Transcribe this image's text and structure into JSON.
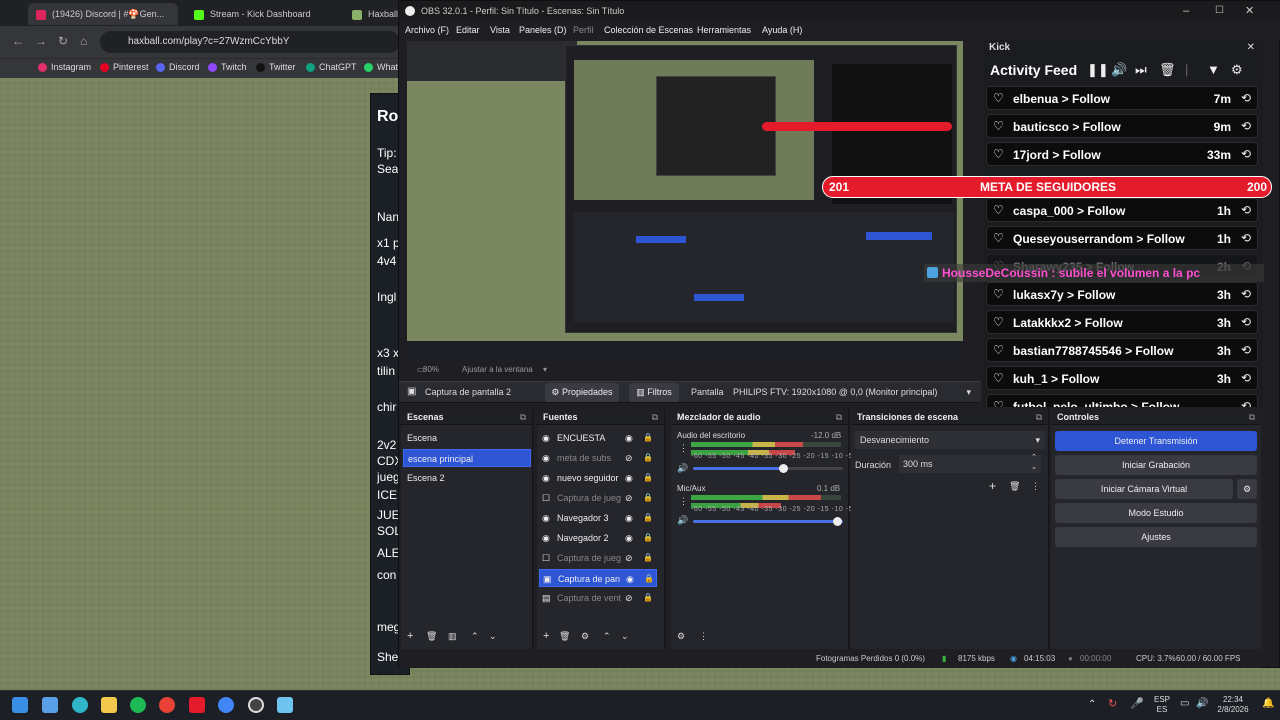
{
  "browser": {
    "tabs": [
      {
        "label": "(19426) Discord | #🍄Gen...",
        "color": "#e0245e"
      },
      {
        "label": "Stream - Kick Dashboard",
        "color": "#53fc18"
      },
      {
        "label": "Haxball Pl",
        "color": "#8ab06a"
      }
    ],
    "url": "haxball.com/play?c=27WzmCcYbbY",
    "bookmarks": [
      {
        "label": "Instagram",
        "color": "#e1306c"
      },
      {
        "label": "Pinterest",
        "color": "#e60023"
      },
      {
        "label": "Discord",
        "color": "#5865f2"
      },
      {
        "label": "Twitch",
        "color": "#9146ff"
      },
      {
        "label": "Twitter",
        "color": "#111111"
      },
      {
        "label": "ChatGPT",
        "color": "#10a37f"
      },
      {
        "label": "Whats",
        "color": "#25d366"
      }
    ]
  },
  "room": {
    "lines": [
      "Ro",
      "Tip:",
      "Sea",
      "Nan",
      "x1 p",
      "4v4",
      "Ingl",
      "x3 x",
      "tilin",
      "chir",
      "2v2",
      "CDX",
      "jueg",
      "ICEE",
      "JUEC",
      "SOL",
      "ALE",
      "con",
      "meg",
      "She"
    ]
  },
  "obs": {
    "title": "OBS 32.0.1 - Perfil: Sin Título - Escenas: Sin Título",
    "menu": [
      "Archivo (F)",
      "Editar",
      "Vista",
      "Paneles (D)",
      "Perfil",
      "Colección de Escenas",
      "Herramientas",
      "Ayuda (H)"
    ],
    "zoom": "80%",
    "zoom_mode": "Ajustar a la ventana",
    "source_bar": {
      "source": "Captura de pantalla 2",
      "properties": "Propiedades",
      "filters": "Filtros",
      "display_label": "Pantalla",
      "display_value": "PHILIPS FTV: 1920x1080 @ 0,0 (Monitor principal)"
    },
    "scenes": {
      "title": "Escenas",
      "items": [
        "Escena",
        "escena principal",
        "Escena 2"
      ]
    },
    "sources": {
      "title": "Fuentes",
      "items": [
        "ENCUESTA",
        "meta de subs",
        "nuevo seguidor",
        "Captura de jueg",
        "Navegador 3",
        "Navegador 2",
        "Captura de jueg",
        "Captura de pan",
        "Captura de vent"
      ]
    },
    "mixer": {
      "title": "Mezclador de audio",
      "channels": [
        {
          "name": "Audio del escritorio",
          "db": "-12.0 dB"
        },
        {
          "name": "Mic/Aux",
          "db": "0.1 dB"
        }
      ],
      "ticks": "-60 -55 -50 -45 -40 -35 -30 -25 -20 -15 -10 -5 0"
    },
    "transitions": {
      "title": "Transiciones de escena",
      "selected": "Desvanecimiento",
      "duration_label": "Duración",
      "duration_value": "300 ms"
    },
    "controls": {
      "title": "Controles",
      "buttons": [
        "Detener Transmisión",
        "Iniciar Grabación",
        "Iniciar Cámara Virtual",
        "Modo Estudio",
        "Ajustes"
      ]
    },
    "status": {
      "dropped": "Fotogramas Perdidos 0 (0.0%)",
      "bitrate": "8175 kbps",
      "stream_time": "04:15:03",
      "rec_time": "00:00:00",
      "cpu": "CPU: 3.7%",
      "fps": "60.00 / 60.00 FPS"
    }
  },
  "kick": {
    "header": "Kick",
    "feed_title": "Activity Feed",
    "follows": [
      {
        "name": "elbenua > Follow",
        "time": "7m"
      },
      {
        "name": "bauticsco > Follow",
        "time": "9m"
      },
      {
        "name": "17jord > Follow",
        "time": "33m"
      },
      {
        "name": "caspa_000 > Follow",
        "time": "1h"
      },
      {
        "name": "Queseyouserrandom > Follow",
        "time": "1h"
      },
      {
        "name": "Sharawy235 > Follow",
        "time": "2h"
      },
      {
        "name": "lukasx7y > Follow",
        "time": "3h"
      },
      {
        "name": "Latakkkx2 > Follow",
        "time": "3h"
      },
      {
        "name": "bastian7788745546 > Follow",
        "time": "3h"
      },
      {
        "name": "kuh_1 > Follow",
        "time": "3h"
      },
      {
        "name": "futbol_pelo_ultimbo > Follow",
        "time": ""
      }
    ],
    "goal": {
      "left": "201",
      "label": "META DE SEGUIDORES",
      "right": "200"
    },
    "chat_message": "HousseDeCoussin : subile el volumen a la pc"
  },
  "taskbar": {
    "lang_top": "ESP",
    "lang_bottom": "ES",
    "time": "22:34",
    "date": "2/8/2026"
  },
  "colors": {
    "accent": "#2d55d4",
    "kick_green": "#53fc18",
    "goal_red": "#e31b2b"
  }
}
